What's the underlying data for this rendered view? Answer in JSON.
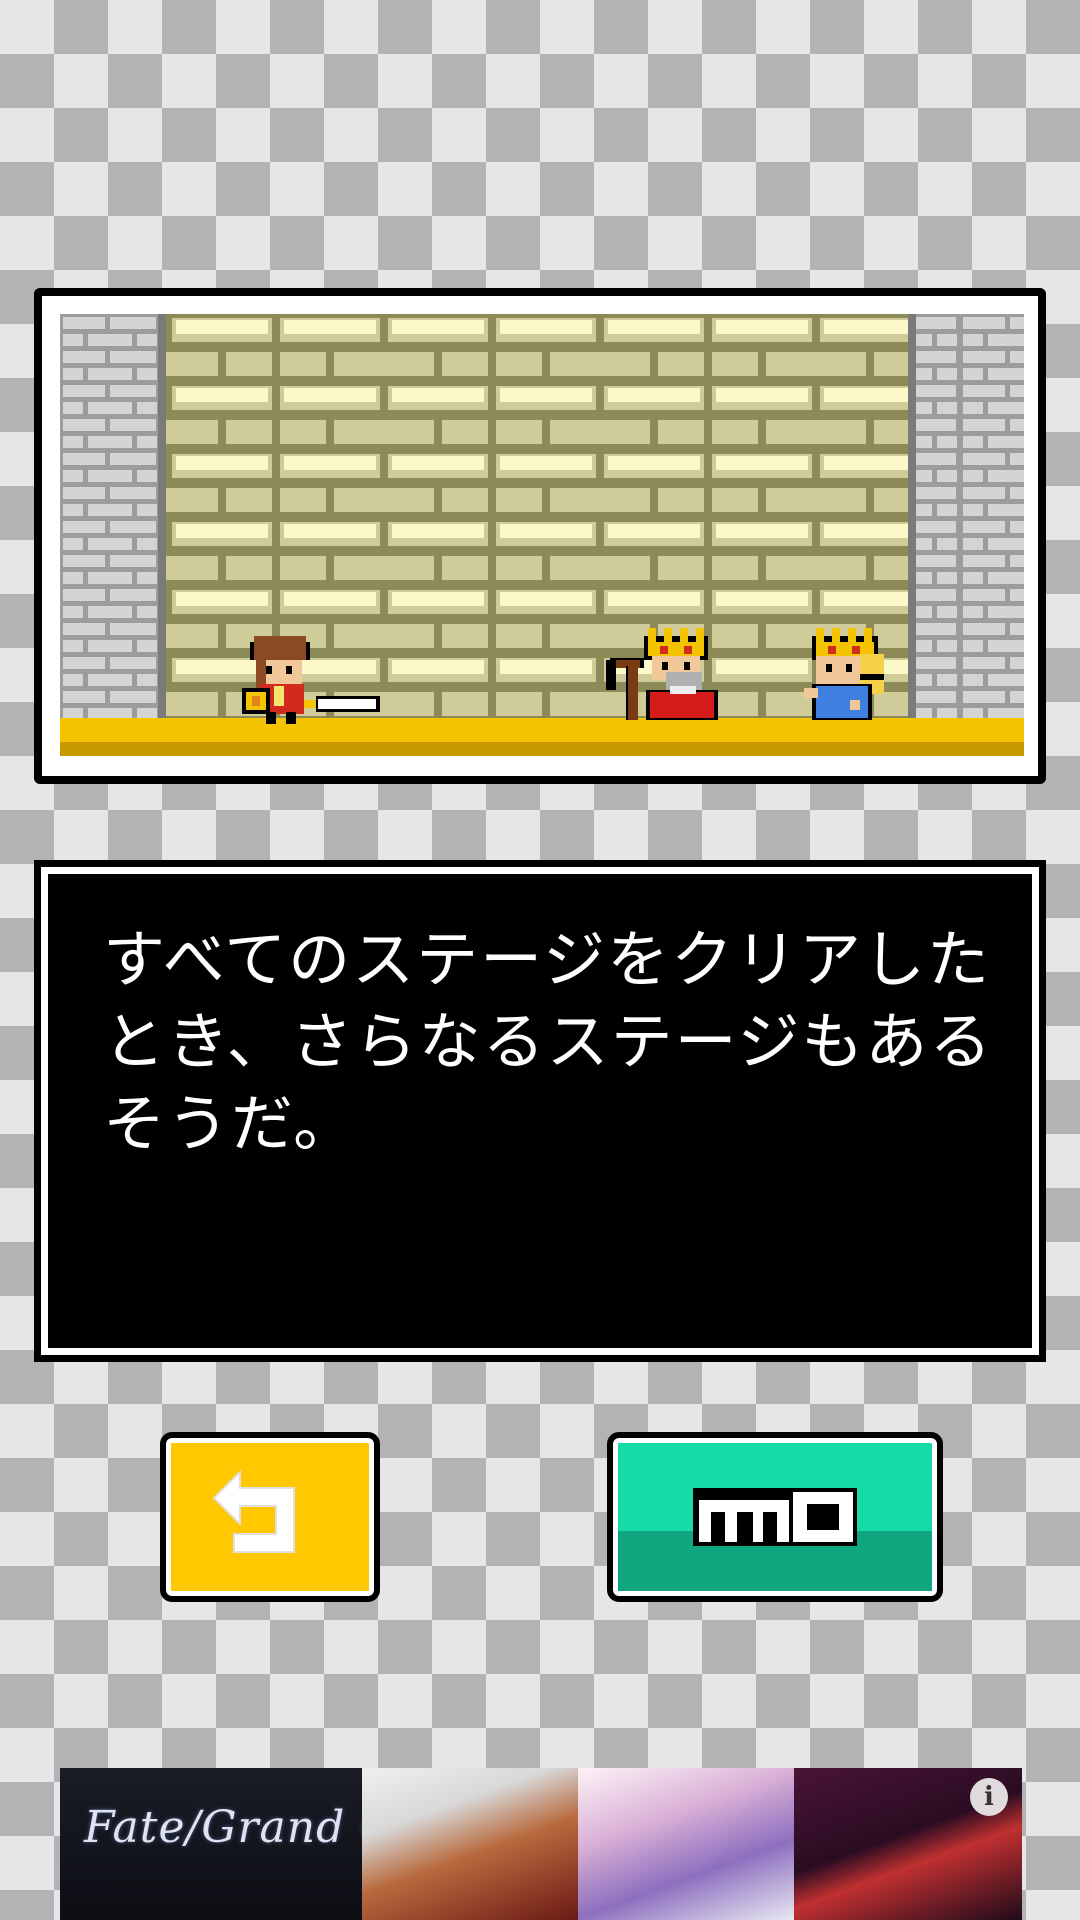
{
  "message": {
    "text": "すべてのステージをクリアした\nとき、さらなるステージもある\nそうだ。"
  },
  "buttons": {
    "back_icon": "return-arrow-icon",
    "key_icon": "key-icon"
  },
  "ad": {
    "logo_text": "Fate/Grand Order",
    "info_icon_glyph": "i"
  },
  "colors": {
    "back_button": "#ffc800",
    "key_button": "#16dba8",
    "floor": "#f5c400"
  }
}
